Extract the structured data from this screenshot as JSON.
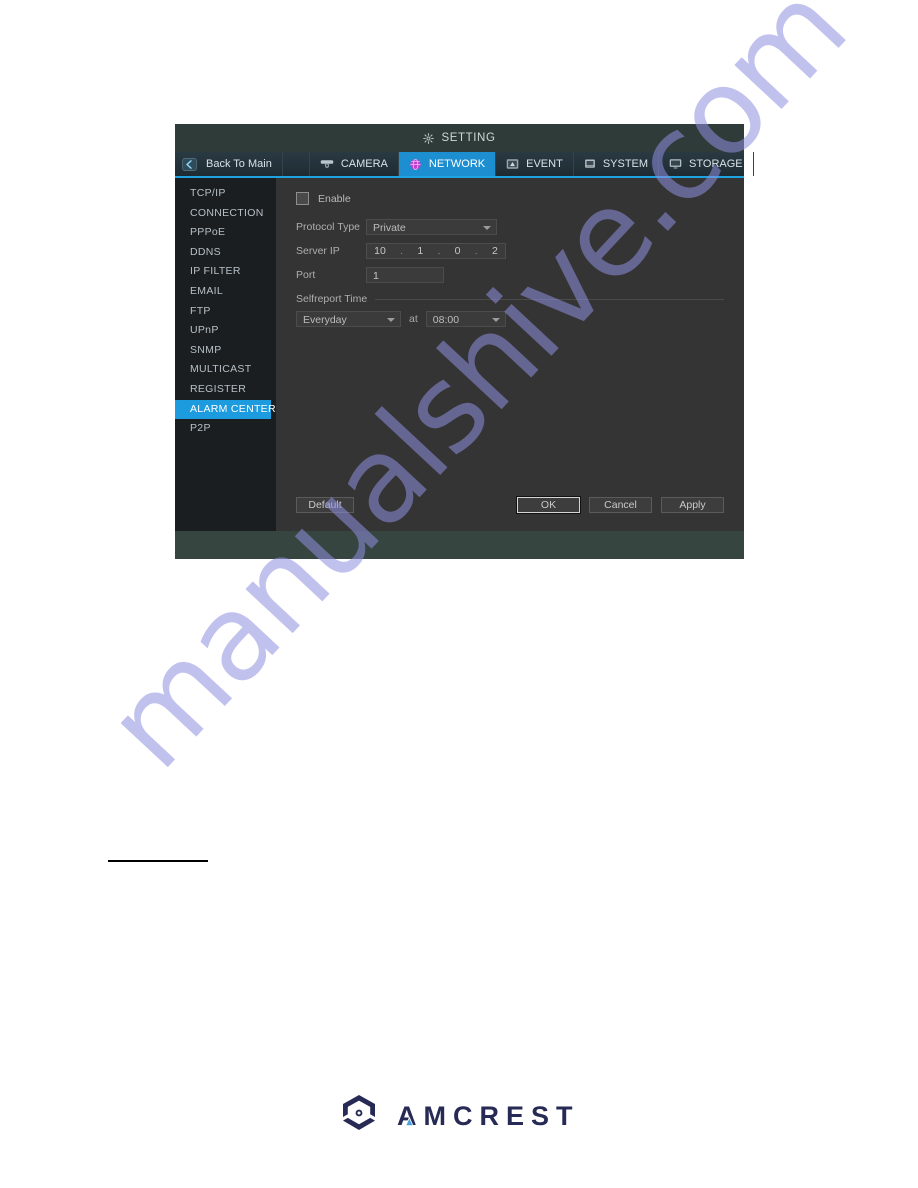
{
  "window": {
    "title": "SETTING",
    "title_icon": "gear-icon"
  },
  "tabs": {
    "back": {
      "label": "Back To Main",
      "icon": "back-arrow-icon"
    },
    "items": [
      {
        "label": "CAMERA",
        "icon": "camera-icon",
        "active": false
      },
      {
        "label": "NETWORK",
        "icon": "globe-icon",
        "active": true
      },
      {
        "label": "EVENT",
        "icon": "event-icon",
        "active": false
      },
      {
        "label": "SYSTEM",
        "icon": "system-icon",
        "active": false
      },
      {
        "label": "STORAGE",
        "icon": "storage-icon",
        "active": false
      }
    ]
  },
  "sidebar": {
    "items": [
      {
        "label": "TCP/IP",
        "active": false
      },
      {
        "label": "CONNECTION",
        "active": false
      },
      {
        "label": "PPPoE",
        "active": false
      },
      {
        "label": "DDNS",
        "active": false
      },
      {
        "label": "IP FILTER",
        "active": false
      },
      {
        "label": "EMAIL",
        "active": false
      },
      {
        "label": "FTP",
        "active": false
      },
      {
        "label": "UPnP",
        "active": false
      },
      {
        "label": "SNMP",
        "active": false
      },
      {
        "label": "MULTICAST",
        "active": false
      },
      {
        "label": "REGISTER",
        "active": false
      },
      {
        "label": "ALARM CENTER",
        "active": true
      },
      {
        "label": "P2P",
        "active": false
      }
    ]
  },
  "form": {
    "enable": {
      "label": "Enable",
      "checked": false
    },
    "protocol_type": {
      "label": "Protocol Type",
      "value": "Private"
    },
    "server_ip": {
      "label": "Server IP",
      "octets": [
        "10",
        "1",
        "0",
        "2"
      ],
      "separator": "."
    },
    "port": {
      "label": "Port",
      "value": "1"
    },
    "selfreport": {
      "section_label": "Selfreport Time",
      "day_value": "Everyday",
      "at_label": "at",
      "time_value": "08:00"
    }
  },
  "buttons": {
    "default": "Default",
    "ok": "OK",
    "cancel": "Cancel",
    "apply": "Apply"
  },
  "watermark": {
    "text": "manualshive.com"
  },
  "logo": {
    "wordmark": "AMCREST"
  },
  "colors": {
    "accent_blue": "#1d9bdf",
    "tab_active": "#1d8fd0",
    "title_bar": "#2e3b38",
    "sidebar_bg": "#1a1e21",
    "content_bg": "#343434",
    "footer_strip": "#36453f",
    "logo_navy": "#262a55",
    "logo_blue": "#3f9fe0",
    "watermark": "#8f8fe0"
  }
}
